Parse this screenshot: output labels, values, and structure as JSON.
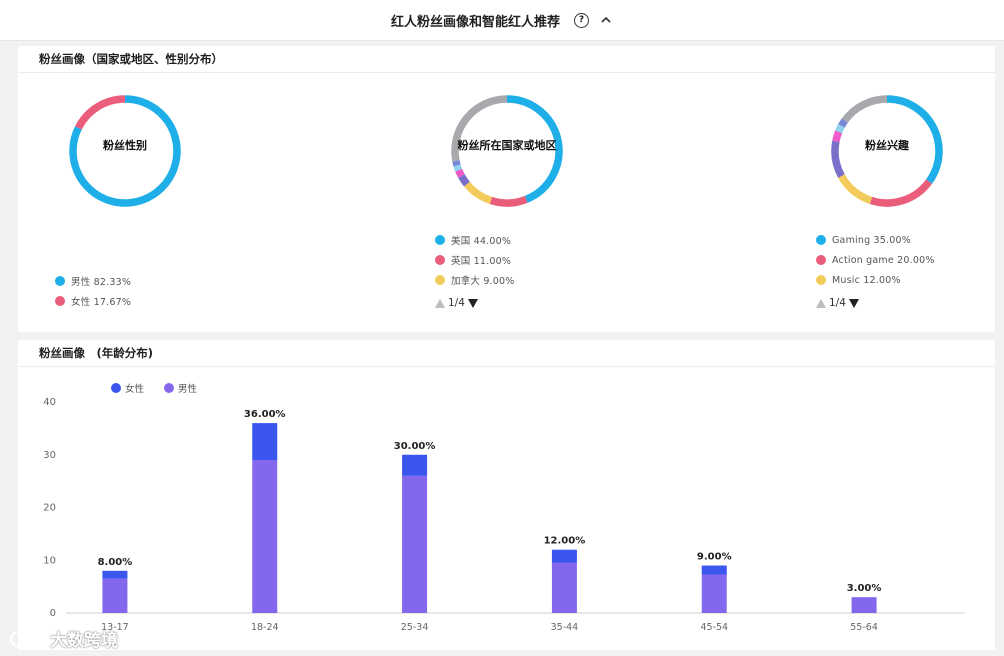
{
  "header": {
    "title": "红人粉丝画像和智能红人推荐",
    "help_symbol": "?"
  },
  "geo_card": {
    "title": "粉丝画像（国家或地区、性别分布）",
    "gender": {
      "center_label": "粉丝性别",
      "items": [
        {
          "label": "男性 82.33%",
          "value": 82.33,
          "color": "#1eaee8"
        },
        {
          "label": "女性 17.67%",
          "value": 17.67,
          "color": "#ea5d7b"
        }
      ]
    },
    "country": {
      "center_label": "粉丝所在国家或地区",
      "items": [
        {
          "label": "美国 44.00%",
          "value": 44.0,
          "color": "#1eaee8"
        },
        {
          "label": "英国 11.00%",
          "value": 11.0,
          "color": "#ea5d7b"
        },
        {
          "label": "加拿大 9.00%",
          "value": 9.0,
          "color": "#f2cb5b"
        }
      ],
      "extra_slices": [
        {
          "value": 3,
          "color": "#7a6fc9"
        },
        {
          "value": 2,
          "color": "#ef5cc9"
        },
        {
          "value": 1.5,
          "color": "#8fd3f0"
        },
        {
          "value": 1.5,
          "color": "#7b8ad8"
        },
        {
          "value": 28,
          "color": "#a7a9ad"
        }
      ],
      "pager": "1/4"
    },
    "interest": {
      "center_label": "粉丝兴趣",
      "items": [
        {
          "label": "Gaming 35.00%",
          "value": 35.0,
          "color": "#1eaee8"
        },
        {
          "label": "Action game 20.00%",
          "value": 20.0,
          "color": "#ea5d7b"
        },
        {
          "label": "Music 12.00%",
          "value": 12.0,
          "color": "#f2cb5b"
        }
      ],
      "extra_slices": [
        {
          "value": 11,
          "color": "#7a6fc9"
        },
        {
          "value": 3,
          "color": "#ef5cc9"
        },
        {
          "value": 2,
          "color": "#8fd3f0"
        },
        {
          "value": 2,
          "color": "#7b8ad8"
        },
        {
          "value": 15,
          "color": "#a7a9ad"
        }
      ],
      "pager": "1/4"
    }
  },
  "age_card": {
    "title": "粉丝画像　(年龄分布)",
    "chart_data": {
      "type": "bar",
      "stacked": true,
      "categories": [
        "13-17",
        "18-24",
        "25-34",
        "35-44",
        "45-54",
        "55-64"
      ],
      "series": [
        {
          "name": "男性",
          "values": [
            6.5,
            29,
            26,
            9.5,
            7.3,
            3
          ],
          "color": "#8368ee"
        },
        {
          "name": "女性",
          "values": [
            1.5,
            7,
            4,
            2.5,
            1.7,
            0
          ],
          "color": "#3b56ef"
        }
      ],
      "totals_labels": [
        "8.00%",
        "36.00%",
        "30.00%",
        "12.00%",
        "9.00%",
        "3.00%"
      ],
      "legend_order": [
        "女性",
        "男性"
      ],
      "legend_position": "top-left",
      "yticks": [
        0,
        10,
        20,
        30,
        40
      ],
      "ylim": [
        0,
        40
      ],
      "grid": false
    }
  },
  "watermark": {
    "text": "大数跨境"
  }
}
